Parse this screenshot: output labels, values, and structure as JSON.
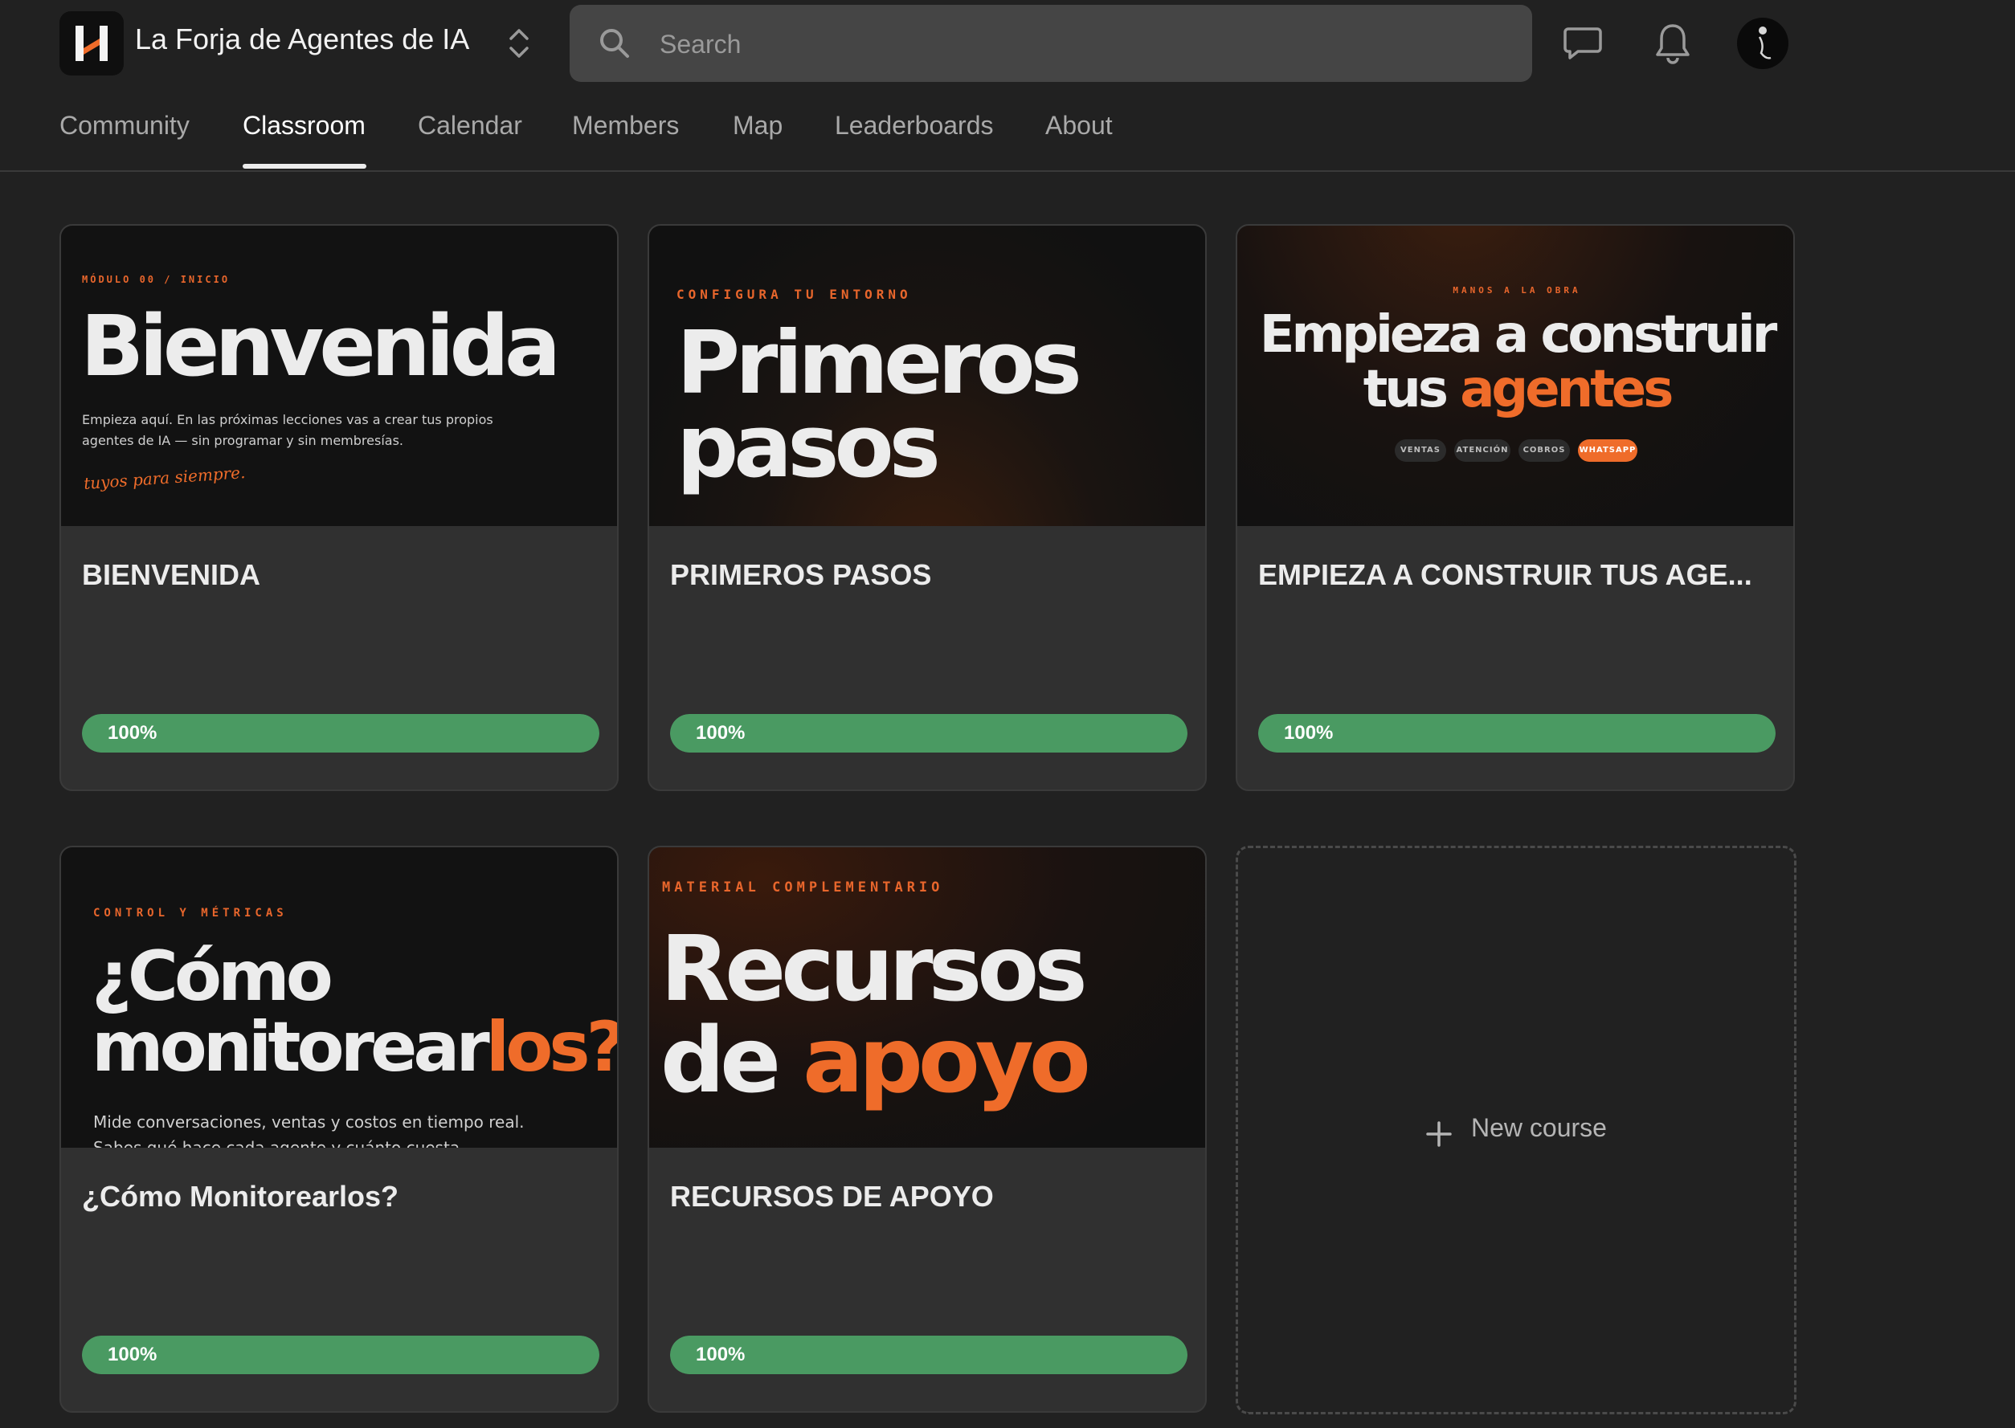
{
  "header": {
    "group_name": "La Forja de Agentes de IA",
    "search_placeholder": "Search",
    "icons": [
      "chat-icon",
      "bell-icon"
    ]
  },
  "tabs": [
    {
      "label": "Community",
      "active": false
    },
    {
      "label": "Classroom",
      "active": true
    },
    {
      "label": "Calendar",
      "active": false
    },
    {
      "label": "Members",
      "active": false
    },
    {
      "label": "Map",
      "active": false
    },
    {
      "label": "Leaderboards",
      "active": false
    },
    {
      "label": "About",
      "active": false
    }
  ],
  "courses": [
    {
      "title": "BIENVENIDA",
      "progress_label": "100%",
      "progress": 1.0,
      "thumb": {
        "kicker": "MÓDULO 00 / INICIO",
        "headline": "Bienvenida",
        "desc_line1": "Empieza aquí. En las próximas lecciones vas a crear tus propios",
        "desc_line2": "agentes de IA — sin programar y sin membresías.",
        "script": "tuyos para siempre."
      }
    },
    {
      "title": "PRIMEROS PASOS",
      "progress_label": "100%",
      "progress": 1.0,
      "thumb": {
        "kicker": "CONFIGURA TU ENTORNO",
        "headline_line1": "Primeros",
        "headline_line2": "pasos"
      }
    },
    {
      "title": "EMPIEZA A CONSTRUIR TUS AGE...",
      "progress_label": "100%",
      "progress": 1.0,
      "thumb": {
        "kicker": "MANOS A LA OBRA",
        "headline_line1": "Empieza a construir",
        "headline_line2a": "tus ",
        "headline_line2b": "agentes",
        "chips": [
          "VENTAS",
          "ATENCIÓN",
          "COBROS",
          "WHATSAPP"
        ]
      }
    },
    {
      "title": "¿Cómo Monitorearlos?",
      "progress_label": "100%",
      "progress": 1.0,
      "thumb": {
        "kicker": "CONTROL Y MÉTRICAS",
        "headline_line1": "¿Cómo",
        "headline_line2a": "monitorear",
        "headline_line2b": "los?",
        "desc_line1": "Mide conversaciones, ventas y costos en tiempo real.",
        "desc_line2": "Sabes qué hace cada agente y cuánto cuesta."
      }
    },
    {
      "title": "RECURSOS DE APOYO",
      "progress_label": "100%",
      "progress": 1.0,
      "thumb": {
        "kicker": "MATERIAL COMPLEMENTARIO",
        "headline_line1": "Recursos",
        "headline_line2a": "de ",
        "headline_line2b": "apoyo"
      }
    }
  ],
  "new_course_label": "New course",
  "colors": {
    "background": "#212121",
    "card": "#303030",
    "accent_orange": "#ef6c2a",
    "progress_green": "#4a9a62"
  }
}
